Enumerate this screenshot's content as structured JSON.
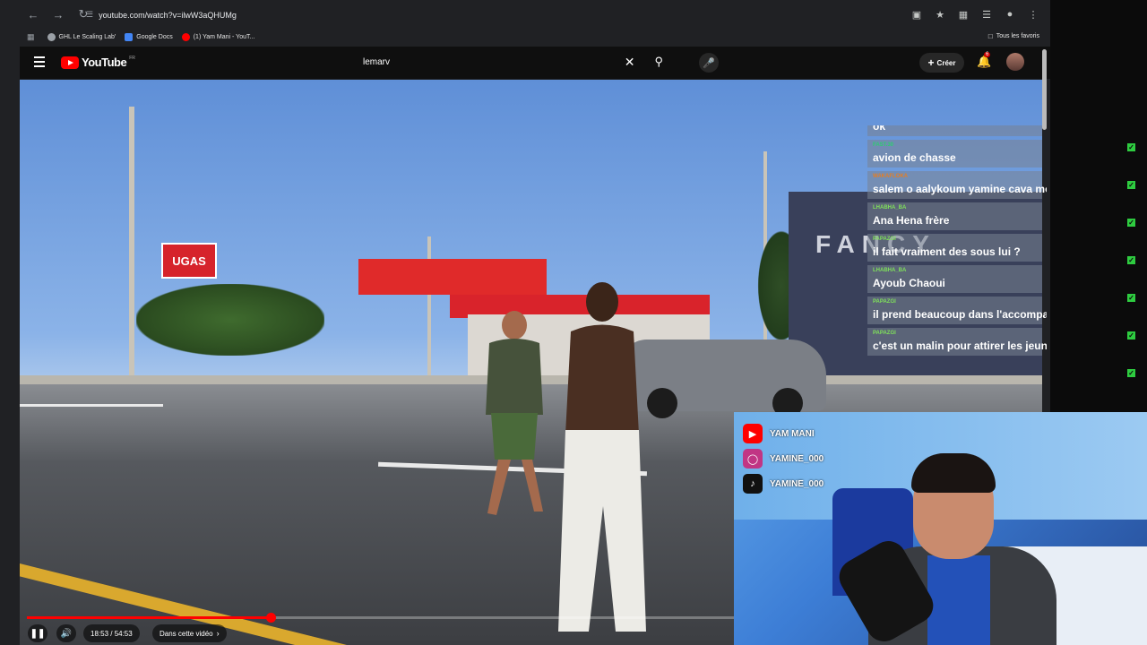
{
  "browser": {
    "url": "youtube.com/watch?v=ilwW3aQHUMg",
    "bookmarks": [
      {
        "label": "GHL Le Scaling Lab'",
        "color": "#9aa0a6"
      },
      {
        "label": "Google Docs",
        "color": "#4285f4"
      },
      {
        "label": "(1) Yam Mani - YouT...",
        "color": "#ff0000"
      }
    ],
    "bookmarks_right": "Tous les favoris"
  },
  "header": {
    "logo_text": "YouTube",
    "logo_region": "FR",
    "search_query": "lemarv",
    "create_label": "Créer",
    "notifications_count": "6"
  },
  "chat": [
    {
      "user": "",
      "text": "ok",
      "user_color": "#ffffff"
    },
    {
      "user": "FAST.30",
      "text": "avion de chasse",
      "user_color": "#2ecc71"
    },
    {
      "user": "WAKAFLOKA",
      "text": "salem o aalykoum yamine cava mon frère",
      "user_color": "#e67e22"
    },
    {
      "user": "LHABHA_BA",
      "text": "Ana Hena frère",
      "user_color": "#7fe05a"
    },
    {
      "user": "PAPAZGI",
      "text": "il fait vraiment des sous lui ?",
      "user_color": "#7fe05a"
    },
    {
      "user": "LHABHA_BA",
      "text": "Ayoub Chaoui",
      "user_color": "#7fe05a"
    },
    {
      "user": "PAPAZGI",
      "text": "il prend beaucoup dans l'accompagnement",
      "user_color": "#7fe05a"
    },
    {
      "user": "PAPAZGI",
      "text": "c'est un malin pour attirer les jeune sa",
      "user_color": "#7fe05a"
    }
  ],
  "socials": [
    {
      "platform": "youtube",
      "handle": "YAM MANI",
      "icon": "youtube-icon",
      "color": "#ff0000"
    },
    {
      "platform": "instagram",
      "handle": "YAMINE_000",
      "icon": "instagram-icon",
      "color": "#c13584"
    },
    {
      "platform": "tiktok",
      "handle": "YAMINE_000",
      "icon": "tiktok-icon",
      "color": "#111111"
    }
  ],
  "scene": {
    "gas_sign": "UGAS",
    "store_sign": "FANCY"
  },
  "player": {
    "current_time": "18:53",
    "duration": "54:53",
    "time_display": "18:53 / 54:53",
    "progress_fraction": 0.344,
    "chapter_label": "Dans cette vidéo"
  }
}
